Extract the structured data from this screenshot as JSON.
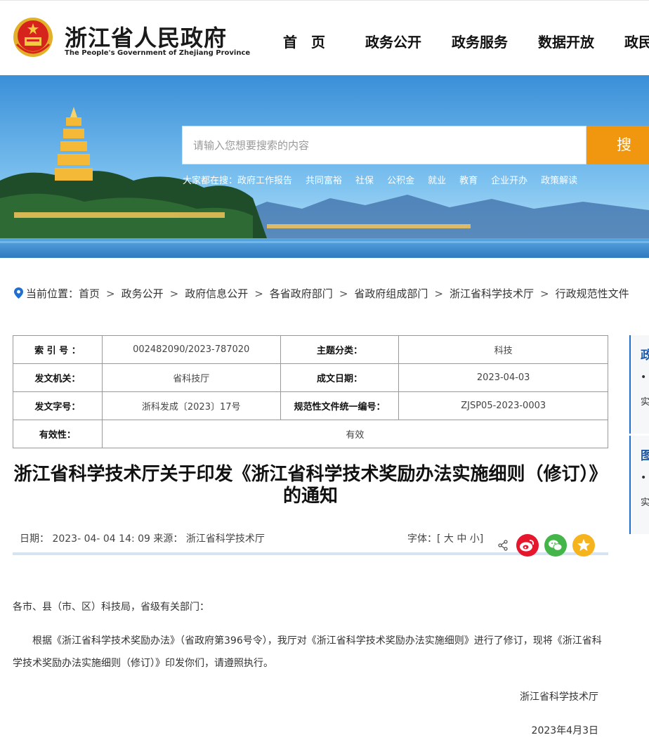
{
  "header": {
    "title": "浙江省人民政府",
    "subtitle": "The People's Government of Zhejiang Province",
    "nav": [
      "首　页",
      "政务公开",
      "政务服务",
      "数据开放",
      "政民"
    ]
  },
  "search": {
    "placeholder": "请输入您想要搜索的内容",
    "button": "搜 索",
    "hot_lead": "大家都在搜：",
    "hot": [
      "政府工作报告",
      "共同富裕",
      "社保",
      "公积金",
      "就业",
      "教育",
      "企业开办",
      "政策解读"
    ]
  },
  "breadcrumb": {
    "lead": "当前位置：",
    "items": [
      "首页",
      "政务公开",
      "政府信息公开",
      "各省政府部门",
      "省政府组成部门",
      "浙江省科学技术厅",
      "行政规范性文件"
    ],
    "separator": ">"
  },
  "meta": {
    "index_label": "索 引 号 ：",
    "index_value": "002482090/2023-787020",
    "topic_label": "主题分类：",
    "topic_value": "科技",
    "issuer_label": "发文机关：",
    "issuer_value": "省科技厅",
    "date_label": "成文日期：",
    "date_value": "2023-04-03",
    "docno_label": "发文字号：",
    "docno_value": "浙科发成〔2023〕17号",
    "code_label": "规范性文件统一编号：",
    "code_value": "ZJSP05-2023-0003",
    "valid_label": "有效性：",
    "valid_value": "有效"
  },
  "article": {
    "title": "浙江省科学技术厅关于印发《浙江省科学技术奖励办法实施细则（修订）》的通知",
    "info": "日期： 2023- 04- 04 14: 09   来源： 浙江省科学技术厅",
    "font_ctrl": "字体：[ 大 中 小]",
    "salutation": "各市、县（市、区）科技局，省级有关部门：",
    "para1": "　　根据《浙江省科学技术奖励办法》（省政府第396号令），我厅对《浙江省科学技术奖励办法实施细则》进行了修订，现将《浙江省科学技术奖励办法实施细则（修订）》印发你们，请遵照执行。",
    "signer": "浙江省科学技术厅",
    "sign_date": "2023年4月3日"
  },
  "sidebar": {
    "box1_title": "政",
    "box1_dot": "•",
    "box1_text": "实",
    "box2_title": "图",
    "box2_dot": "•",
    "box2_text": "实"
  },
  "colors": {
    "accent_orange": "#f0960f",
    "title_blue": "#1f5aa8",
    "weibo_red": "#e6162d",
    "wechat_green": "#44b549",
    "fav_yellow": "#f5b41e"
  }
}
